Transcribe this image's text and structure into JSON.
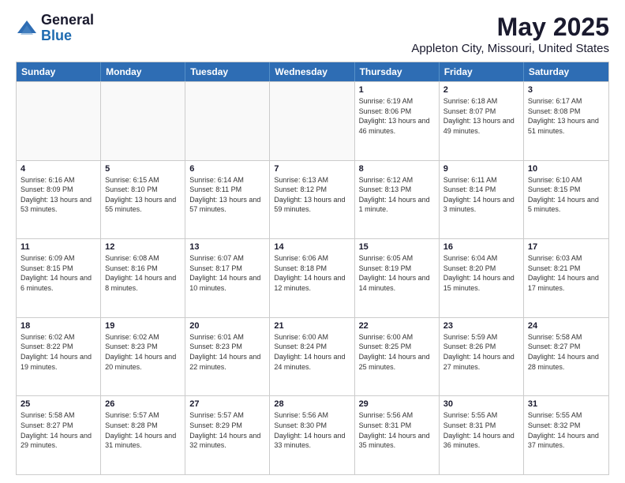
{
  "header": {
    "logo_general": "General",
    "logo_blue": "Blue",
    "month_title": "May 2025",
    "location": "Appleton City, Missouri, United States"
  },
  "days_of_week": [
    "Sunday",
    "Monday",
    "Tuesday",
    "Wednesday",
    "Thursday",
    "Friday",
    "Saturday"
  ],
  "weeks": [
    [
      {
        "day": "",
        "empty": true
      },
      {
        "day": "",
        "empty": true
      },
      {
        "day": "",
        "empty": true
      },
      {
        "day": "",
        "empty": true
      },
      {
        "day": "1",
        "sunrise": "6:19 AM",
        "sunset": "8:06 PM",
        "daylight": "13 hours and 46 minutes."
      },
      {
        "day": "2",
        "sunrise": "6:18 AM",
        "sunset": "8:07 PM",
        "daylight": "13 hours and 49 minutes."
      },
      {
        "day": "3",
        "sunrise": "6:17 AM",
        "sunset": "8:08 PM",
        "daylight": "13 hours and 51 minutes."
      }
    ],
    [
      {
        "day": "4",
        "sunrise": "6:16 AM",
        "sunset": "8:09 PM",
        "daylight": "13 hours and 53 minutes."
      },
      {
        "day": "5",
        "sunrise": "6:15 AM",
        "sunset": "8:10 PM",
        "daylight": "13 hours and 55 minutes."
      },
      {
        "day": "6",
        "sunrise": "6:14 AM",
        "sunset": "8:11 PM",
        "daylight": "13 hours and 57 minutes."
      },
      {
        "day": "7",
        "sunrise": "6:13 AM",
        "sunset": "8:12 PM",
        "daylight": "13 hours and 59 minutes."
      },
      {
        "day": "8",
        "sunrise": "6:12 AM",
        "sunset": "8:13 PM",
        "daylight": "14 hours and 1 minute."
      },
      {
        "day": "9",
        "sunrise": "6:11 AM",
        "sunset": "8:14 PM",
        "daylight": "14 hours and 3 minutes."
      },
      {
        "day": "10",
        "sunrise": "6:10 AM",
        "sunset": "8:15 PM",
        "daylight": "14 hours and 5 minutes."
      }
    ],
    [
      {
        "day": "11",
        "sunrise": "6:09 AM",
        "sunset": "8:15 PM",
        "daylight": "14 hours and 6 minutes."
      },
      {
        "day": "12",
        "sunrise": "6:08 AM",
        "sunset": "8:16 PM",
        "daylight": "14 hours and 8 minutes."
      },
      {
        "day": "13",
        "sunrise": "6:07 AM",
        "sunset": "8:17 PM",
        "daylight": "14 hours and 10 minutes."
      },
      {
        "day": "14",
        "sunrise": "6:06 AM",
        "sunset": "8:18 PM",
        "daylight": "14 hours and 12 minutes."
      },
      {
        "day": "15",
        "sunrise": "6:05 AM",
        "sunset": "8:19 PM",
        "daylight": "14 hours and 14 minutes."
      },
      {
        "day": "16",
        "sunrise": "6:04 AM",
        "sunset": "8:20 PM",
        "daylight": "14 hours and 15 minutes."
      },
      {
        "day": "17",
        "sunrise": "6:03 AM",
        "sunset": "8:21 PM",
        "daylight": "14 hours and 17 minutes."
      }
    ],
    [
      {
        "day": "18",
        "sunrise": "6:02 AM",
        "sunset": "8:22 PM",
        "daylight": "14 hours and 19 minutes."
      },
      {
        "day": "19",
        "sunrise": "6:02 AM",
        "sunset": "8:23 PM",
        "daylight": "14 hours and 20 minutes."
      },
      {
        "day": "20",
        "sunrise": "6:01 AM",
        "sunset": "8:23 PM",
        "daylight": "14 hours and 22 minutes."
      },
      {
        "day": "21",
        "sunrise": "6:00 AM",
        "sunset": "8:24 PM",
        "daylight": "14 hours and 24 minutes."
      },
      {
        "day": "22",
        "sunrise": "6:00 AM",
        "sunset": "8:25 PM",
        "daylight": "14 hours and 25 minutes."
      },
      {
        "day": "23",
        "sunrise": "5:59 AM",
        "sunset": "8:26 PM",
        "daylight": "14 hours and 27 minutes."
      },
      {
        "day": "24",
        "sunrise": "5:58 AM",
        "sunset": "8:27 PM",
        "daylight": "14 hours and 28 minutes."
      }
    ],
    [
      {
        "day": "25",
        "sunrise": "5:58 AM",
        "sunset": "8:27 PM",
        "daylight": "14 hours and 29 minutes."
      },
      {
        "day": "26",
        "sunrise": "5:57 AM",
        "sunset": "8:28 PM",
        "daylight": "14 hours and 31 minutes."
      },
      {
        "day": "27",
        "sunrise": "5:57 AM",
        "sunset": "8:29 PM",
        "daylight": "14 hours and 32 minutes."
      },
      {
        "day": "28",
        "sunrise": "5:56 AM",
        "sunset": "8:30 PM",
        "daylight": "14 hours and 33 minutes."
      },
      {
        "day": "29",
        "sunrise": "5:56 AM",
        "sunset": "8:31 PM",
        "daylight": "14 hours and 35 minutes."
      },
      {
        "day": "30",
        "sunrise": "5:55 AM",
        "sunset": "8:31 PM",
        "daylight": "14 hours and 36 minutes."
      },
      {
        "day": "31",
        "sunrise": "5:55 AM",
        "sunset": "8:32 PM",
        "daylight": "14 hours and 37 minutes."
      }
    ]
  ]
}
